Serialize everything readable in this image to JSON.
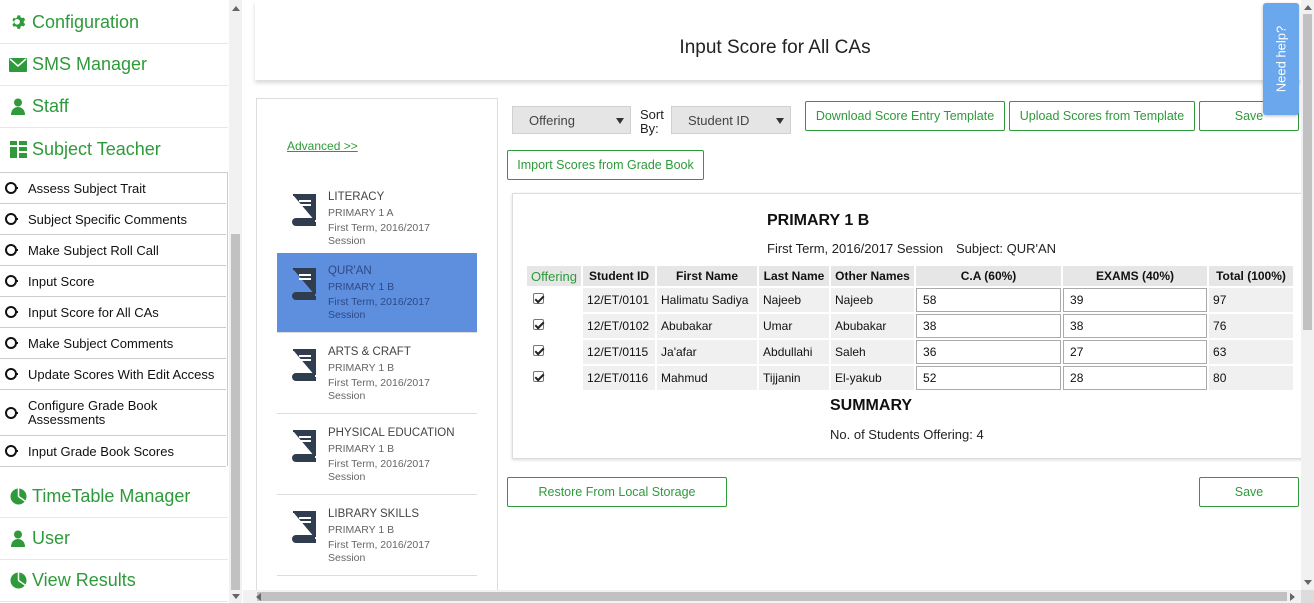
{
  "sidebar": {
    "configuration": "Configuration",
    "sms_manager": "SMS Manager",
    "staff": "Staff",
    "subject_teacher": "Subject Teacher",
    "subitems": [
      "Assess Subject Trait",
      "Subject Specific Comments",
      "Make Subject Roll Call",
      "Input Score",
      "Input Score for All CAs",
      "Make Subject Comments",
      "Update Scores With Edit Access",
      "Configure Grade Book Assessments",
      "Input Grade Book Scores"
    ],
    "timetable_manager": "TimeTable Manager",
    "user": "User",
    "view_results": "View Results"
  },
  "page": {
    "title": "Input Score for All CAs"
  },
  "courses_panel": {
    "advanced_link": "Advanced >>",
    "courses": [
      {
        "name": "LITERACY",
        "class": "PRIMARY 1 A",
        "term": "First Term, 2016/2017 Session"
      },
      {
        "name": "QUR'AN",
        "class": "PRIMARY 1 B",
        "term": "First Term, 2016/2017 Session"
      },
      {
        "name": "ARTS & CRAFT",
        "class": "PRIMARY 1 B",
        "term": "First Term, 2016/2017 Session"
      },
      {
        "name": "PHYSICAL EDUCATION",
        "class": "PRIMARY 1 B",
        "term": "First Term, 2016/2017 Session"
      },
      {
        "name": "LIBRARY SKILLS",
        "class": "PRIMARY 1 B",
        "term": "First Term, 2016/2017 Session"
      }
    ]
  },
  "controls": {
    "filter_select": "Offering",
    "sort_label": "Sort By:",
    "sort_label_1": "Sort",
    "sort_label_2": "By:",
    "sort_select": "Student ID",
    "download_template": "Download Score Entry Template",
    "upload_template": "Upload Scores from Template",
    "save": "Save",
    "import_gradebook": "Import Scores from Grade Book",
    "restore_local": "Restore From Local Storage",
    "save_bottom": "Save"
  },
  "score_sheet": {
    "class_title": "PRIMARY 1 B",
    "term": "First Term, 2016/2017 Session",
    "subject": "Subject: QUR'AN",
    "headers": [
      "Offering",
      "Student ID",
      "First Name",
      "Last Name",
      "Other Names",
      "C.A (60%)",
      "EXAMS (40%)",
      "Total (100%)"
    ],
    "rows": [
      {
        "offering": true,
        "student_id": "12/ET/0101",
        "first_name": "Halimatu Sadiya",
        "last_name": "Najeeb",
        "other_names": "Najeeb",
        "ca": "58",
        "exams": "39",
        "total": "97"
      },
      {
        "offering": true,
        "student_id": "12/ET/0102",
        "first_name": "Abubakar",
        "last_name": "Umar",
        "other_names": "Abubakar",
        "ca": "38",
        "exams": "38",
        "total": "76"
      },
      {
        "offering": true,
        "student_id": "12/ET/0115",
        "first_name": "Ja'afar",
        "last_name": "Abdullahi",
        "other_names": "Saleh",
        "ca": "36",
        "exams": "27",
        "total": "63"
      },
      {
        "offering": true,
        "student_id": "12/ET/0116",
        "first_name": "Mahmud",
        "last_name": "Tijjanin",
        "other_names": "El-yakub",
        "ca": "52",
        "exams": "28",
        "total": "80"
      }
    ],
    "summary_title": "SUMMARY",
    "summary_line": "No. of Students Offering: 4"
  },
  "help": {
    "label": "Need help?"
  },
  "colors": {
    "accent_green": "#2e9a3a",
    "active_course": "#5e8ede",
    "help_tab": "#6aa7ec"
  }
}
